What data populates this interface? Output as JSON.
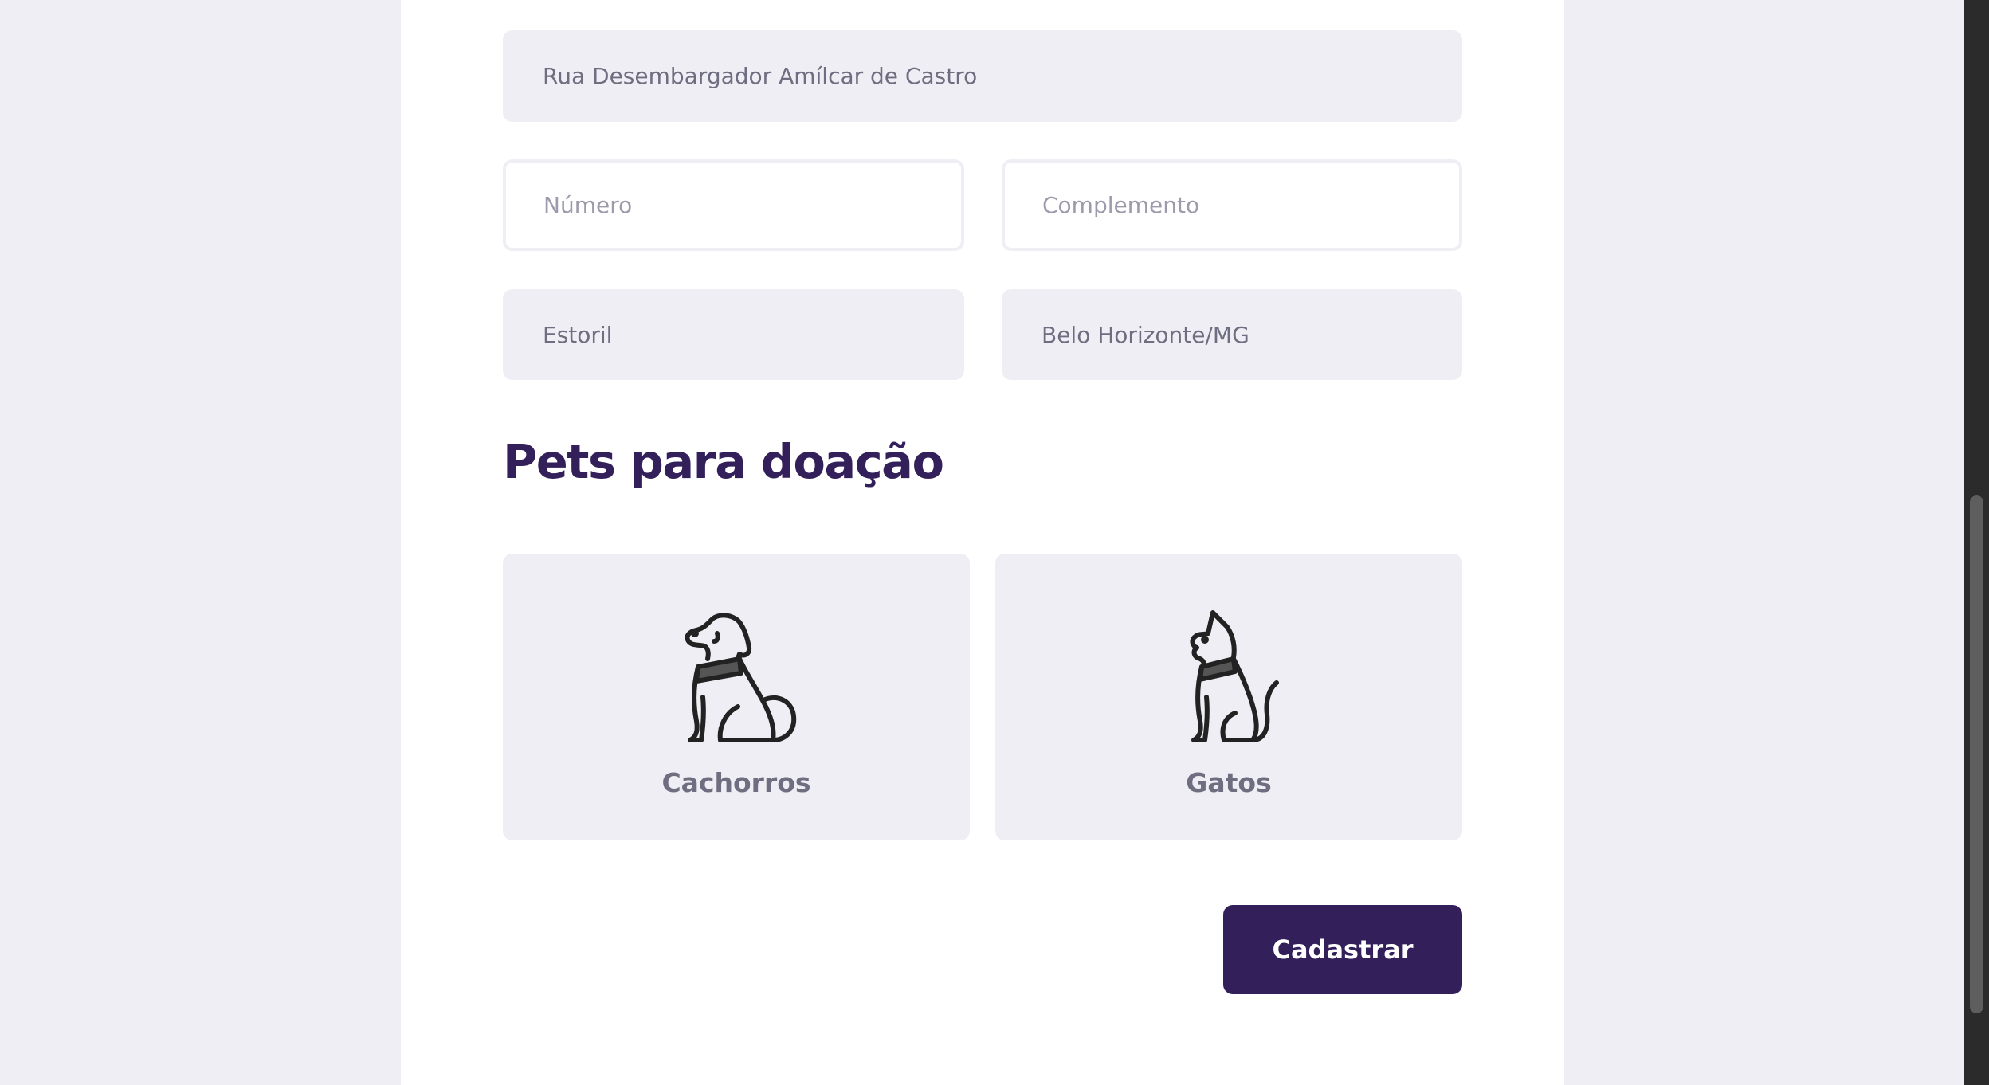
{
  "address": {
    "street_value": "Rua Desembargador Amílcar de Castro",
    "number_placeholder": "Número",
    "complement_placeholder": "Complemento",
    "neighborhood_value": "Estoril",
    "city_value": "Belo Horizonte/MG"
  },
  "pets_section": {
    "title": "Pets para doação",
    "options": [
      {
        "label": "Cachorros",
        "icon": "dog-icon"
      },
      {
        "label": "Gatos",
        "icon": "cat-icon"
      }
    ]
  },
  "actions": {
    "submit_label": "Cadastrar"
  },
  "colors": {
    "brand": "#33205a",
    "field_bg": "#efeef4",
    "text_muted": "#6f6d80",
    "placeholder": "#9c9aab"
  }
}
